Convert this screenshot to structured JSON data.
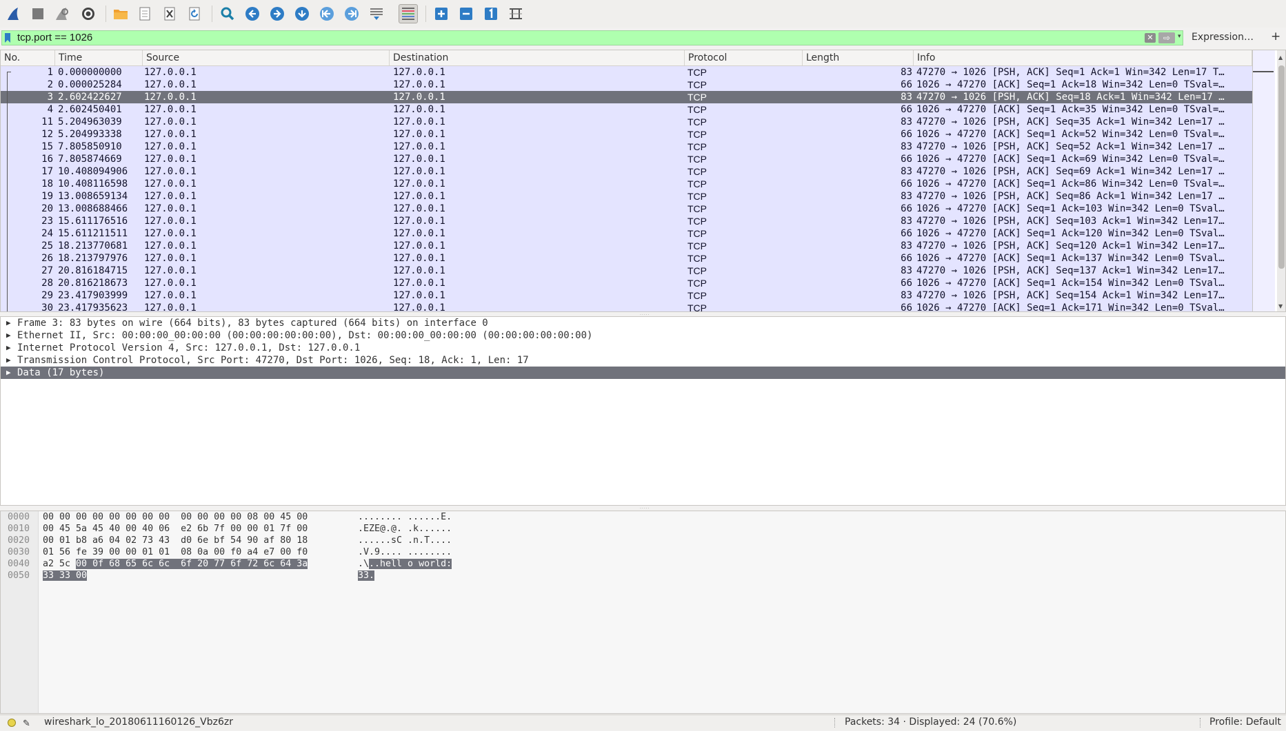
{
  "filter": {
    "value": "tcp.port == 1026",
    "clear_symbol": "✕",
    "apply_symbol": "⇨",
    "dropdown_symbol": "▾",
    "expression_label": "Expression…",
    "add_label": "+"
  },
  "packet_list": {
    "columns": [
      "No.",
      "Time",
      "Source",
      "Destination",
      "Protocol",
      "Length",
      "Info"
    ],
    "selected_index": 2,
    "rows": [
      {
        "no": "1",
        "time": "0.000000000",
        "src": "127.0.0.1",
        "dst": "127.0.0.1",
        "proto": "TCP",
        "len": "83",
        "info": "47270 → 1026 [PSH, ACK] Seq=1 Ack=1 Win=342 Len=17 T…"
      },
      {
        "no": "2",
        "time": "0.000025284",
        "src": "127.0.0.1",
        "dst": "127.0.0.1",
        "proto": "TCP",
        "len": "66",
        "info": "1026 → 47270 [ACK] Seq=1 Ack=18 Win=342 Len=0 TSval=…"
      },
      {
        "no": "3",
        "time": "2.602422627",
        "src": "127.0.0.1",
        "dst": "127.0.0.1",
        "proto": "TCP",
        "len": "83",
        "info": "47270 → 1026 [PSH, ACK] Seq=18 Ack=1 Win=342 Len=17 …"
      },
      {
        "no": "4",
        "time": "2.602450401",
        "src": "127.0.0.1",
        "dst": "127.0.0.1",
        "proto": "TCP",
        "len": "66",
        "info": "1026 → 47270 [ACK] Seq=1 Ack=35 Win=342 Len=0 TSval=…"
      },
      {
        "no": "11",
        "time": "5.204963039",
        "src": "127.0.0.1",
        "dst": "127.0.0.1",
        "proto": "TCP",
        "len": "83",
        "info": "47270 → 1026 [PSH, ACK] Seq=35 Ack=1 Win=342 Len=17 …"
      },
      {
        "no": "12",
        "time": "5.204993338",
        "src": "127.0.0.1",
        "dst": "127.0.0.1",
        "proto": "TCP",
        "len": "66",
        "info": "1026 → 47270 [ACK] Seq=1 Ack=52 Win=342 Len=0 TSval=…"
      },
      {
        "no": "15",
        "time": "7.805850910",
        "src": "127.0.0.1",
        "dst": "127.0.0.1",
        "proto": "TCP",
        "len": "83",
        "info": "47270 → 1026 [PSH, ACK] Seq=52 Ack=1 Win=342 Len=17 …"
      },
      {
        "no": "16",
        "time": "7.805874669",
        "src": "127.0.0.1",
        "dst": "127.0.0.1",
        "proto": "TCP",
        "len": "66",
        "info": "1026 → 47270 [ACK] Seq=1 Ack=69 Win=342 Len=0 TSval=…"
      },
      {
        "no": "17",
        "time": "10.408094906",
        "src": "127.0.0.1",
        "dst": "127.0.0.1",
        "proto": "TCP",
        "len": "83",
        "info": "47270 → 1026 [PSH, ACK] Seq=69 Ack=1 Win=342 Len=17 …"
      },
      {
        "no": "18",
        "time": "10.408116598",
        "src": "127.0.0.1",
        "dst": "127.0.0.1",
        "proto": "TCP",
        "len": "66",
        "info": "1026 → 47270 [ACK] Seq=1 Ack=86 Win=342 Len=0 TSval=…"
      },
      {
        "no": "19",
        "time": "13.008659134",
        "src": "127.0.0.1",
        "dst": "127.0.0.1",
        "proto": "TCP",
        "len": "83",
        "info": "47270 → 1026 [PSH, ACK] Seq=86 Ack=1 Win=342 Len=17 …"
      },
      {
        "no": "20",
        "time": "13.008688466",
        "src": "127.0.0.1",
        "dst": "127.0.0.1",
        "proto": "TCP",
        "len": "66",
        "info": "1026 → 47270 [ACK] Seq=1 Ack=103 Win=342 Len=0 TSval…"
      },
      {
        "no": "23",
        "time": "15.611176516",
        "src": "127.0.0.1",
        "dst": "127.0.0.1",
        "proto": "TCP",
        "len": "83",
        "info": "47270 → 1026 [PSH, ACK] Seq=103 Ack=1 Win=342 Len=17…"
      },
      {
        "no": "24",
        "time": "15.611211511",
        "src": "127.0.0.1",
        "dst": "127.0.0.1",
        "proto": "TCP",
        "len": "66",
        "info": "1026 → 47270 [ACK] Seq=1 Ack=120 Win=342 Len=0 TSval…"
      },
      {
        "no": "25",
        "time": "18.213770681",
        "src": "127.0.0.1",
        "dst": "127.0.0.1",
        "proto": "TCP",
        "len": "83",
        "info": "47270 → 1026 [PSH, ACK] Seq=120 Ack=1 Win=342 Len=17…"
      },
      {
        "no": "26",
        "time": "18.213797976",
        "src": "127.0.0.1",
        "dst": "127.0.0.1",
        "proto": "TCP",
        "len": "66",
        "info": "1026 → 47270 [ACK] Seq=1 Ack=137 Win=342 Len=0 TSval…"
      },
      {
        "no": "27",
        "time": "20.816184715",
        "src": "127.0.0.1",
        "dst": "127.0.0.1",
        "proto": "TCP",
        "len": "83",
        "info": "47270 → 1026 [PSH, ACK] Seq=137 Ack=1 Win=342 Len=17…"
      },
      {
        "no": "28",
        "time": "20.816218673",
        "src": "127.0.0.1",
        "dst": "127.0.0.1",
        "proto": "TCP",
        "len": "66",
        "info": "1026 → 47270 [ACK] Seq=1 Ack=154 Win=342 Len=0 TSval…"
      },
      {
        "no": "29",
        "time": "23.417903999",
        "src": "127.0.0.1",
        "dst": "127.0.0.1",
        "proto": "TCP",
        "len": "83",
        "info": "47270 → 1026 [PSH, ACK] Seq=154 Ack=1 Win=342 Len=17…"
      },
      {
        "no": "30",
        "time": "23.417935623",
        "src": "127.0.0.1",
        "dst": "127.0.0.1",
        "proto": "TCP",
        "len": "66",
        "info": "1026 → 47270 [ACK] Seq=1 Ack=171 Win=342 Len=0 TSval…"
      }
    ]
  },
  "details": {
    "selected_index": 4,
    "items": [
      "Frame 3: 83 bytes on wire (664 bits), 83 bytes captured (664 bits) on interface 0",
      "Ethernet II, Src: 00:00:00_00:00:00 (00:00:00:00:00:00), Dst: 00:00:00_00:00:00 (00:00:00:00:00:00)",
      "Internet Protocol Version 4, Src: 127.0.0.1, Dst: 127.0.0.1",
      "Transmission Control Protocol, Src Port: 47270, Dst Port: 1026, Seq: 18, Ack: 1, Len: 17",
      "Data (17 bytes)"
    ]
  },
  "bytes": {
    "rows": [
      {
        "offset": "0000",
        "hex": "00 00 00 00 00 00 00 00  00 00 00 00 08 00 45 00",
        "ascii": "........ ......E."
      },
      {
        "offset": "0010",
        "hex": "00 45 5a 45 40 00 40 06  e2 6b 7f 00 00 01 7f 00",
        "ascii": ".EZE@.@. .k......"
      },
      {
        "offset": "0020",
        "hex": "00 01 b8 a6 04 02 73 43  d0 6e bf 54 90 af 80 18",
        "ascii": "......sC .n.T...."
      },
      {
        "offset": "0030",
        "hex": "01 56 fe 39 00 00 01 01  08 0a 00 f0 a4 e7 00 f0",
        "ascii": ".V.9.... ........"
      },
      {
        "offset": "0040",
        "hex_plain": "a2 5c ",
        "hex_hl": "00 0f 68 65 6c 6c  6f 20 77 6f 72 6c 64 3a",
        "ascii_plain": ".\\",
        "ascii_hl": "..hell o world:"
      },
      {
        "offset": "0050",
        "hex_plain": "",
        "hex_hl": "33 33 00",
        "ascii_plain": "",
        "ascii_hl": "33."
      }
    ]
  },
  "status": {
    "edit_symbol": "✎",
    "file": "wireshark_lo_20180611160126_Vbz6zr",
    "packets": "Packets: 34 · Displayed: 24 (70.6%)",
    "profile": "Profile: Default"
  },
  "colors": {
    "row_tcp": "#e4e4ff",
    "selected": "#70727b",
    "filter_ok": "#afffaf",
    "toolbar_blue": "#2e7cc5",
    "fin_blue": "#2a5ca8"
  }
}
